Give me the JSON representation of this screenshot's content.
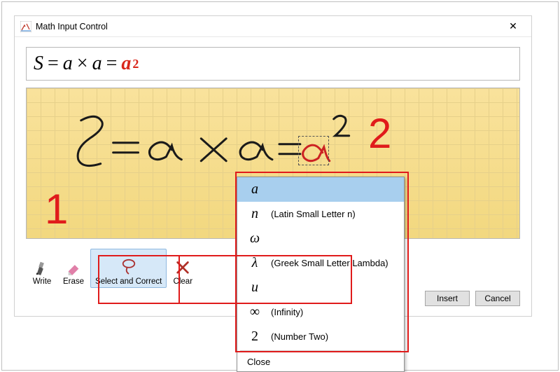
{
  "window": {
    "title": "Math Input Control",
    "close_glyph": "✕"
  },
  "formula": {
    "S": "S",
    "eq1": "=",
    "a1": "a",
    "times": "×",
    "a2": "a",
    "eq2": "=",
    "red_a": "a",
    "red_exp": "2"
  },
  "toolbar": {
    "write": "Write",
    "erase": "Erase",
    "select_correct": "Select and Correct",
    "clear": "Clear"
  },
  "footer": {
    "insert": "Insert",
    "cancel": "Cancel"
  },
  "popup": {
    "items": [
      {
        "sym": "a",
        "desc": "",
        "italic": true,
        "selected": true
      },
      {
        "sym": "n",
        "desc": "(Latin Small Letter n)",
        "italic": true
      },
      {
        "sym": "ω",
        "desc": "",
        "italic": true
      },
      {
        "sym": "λ",
        "desc": "(Greek Small Letter Lambda)",
        "italic": true
      },
      {
        "sym": "u",
        "desc": "",
        "italic": true
      },
      {
        "sym": "∞",
        "desc": "(Infinity)",
        "italic": false
      },
      {
        "sym": "2",
        "desc": "(Number Two)",
        "italic": false
      }
    ],
    "close": "Close"
  },
  "annotations": {
    "label1": "1",
    "label2": "2"
  }
}
